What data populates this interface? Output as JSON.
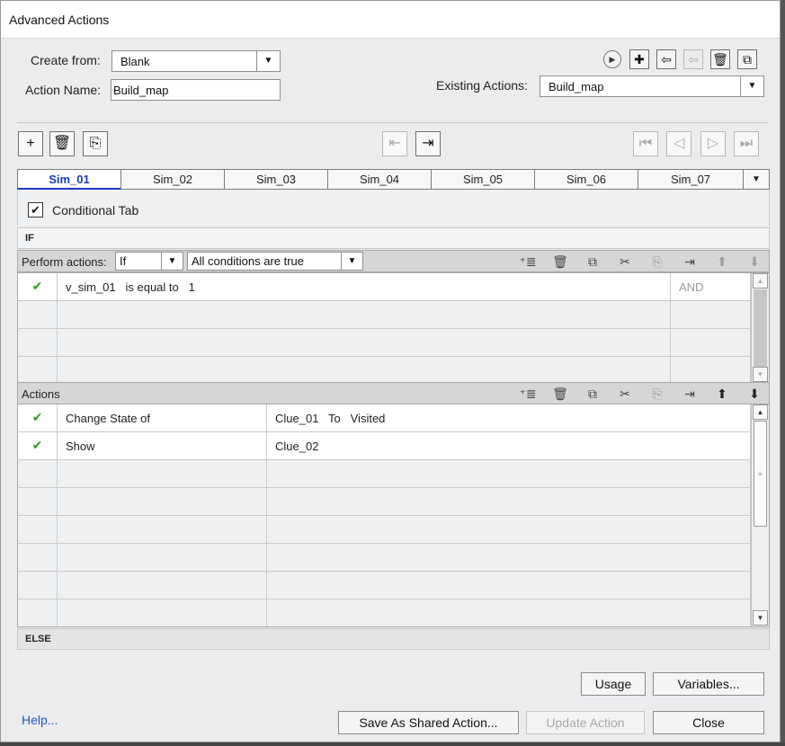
{
  "window": {
    "title": "Advanced Actions"
  },
  "form": {
    "create_from_label": "Create from:",
    "create_from_value": "Blank",
    "action_name_label": "Action Name:",
    "action_name_value": "Build_map",
    "existing_label": "Existing Actions:",
    "existing_value": "Build_map"
  },
  "tabs": [
    "Sim_01",
    "Sim_02",
    "Sim_03",
    "Sim_04",
    "Sim_05",
    "Sim_06",
    "Sim_07"
  ],
  "conditional_tab": {
    "label": "Conditional Tab",
    "checked": true
  },
  "if_label": "IF",
  "perform": {
    "label": "Perform actions:",
    "mode": "If",
    "condition_mode": "All conditions are true"
  },
  "conditions": [
    {
      "var": "v_sim_01",
      "op": "is equal to",
      "value": "1",
      "logic": "AND"
    }
  ],
  "actions_header": "Actions",
  "actions": [
    {
      "action": "Change State of",
      "target": "Clue_01",
      "to_label": "To",
      "state": "Visited"
    },
    {
      "action": "Show",
      "target": "Clue_02"
    }
  ],
  "else_label": "ELSE",
  "buttons": {
    "usage": "Usage",
    "variables": "Variables...",
    "save_shared": "Save As Shared Action...",
    "update": "Update Action",
    "close": "Close",
    "help": "Help..."
  }
}
